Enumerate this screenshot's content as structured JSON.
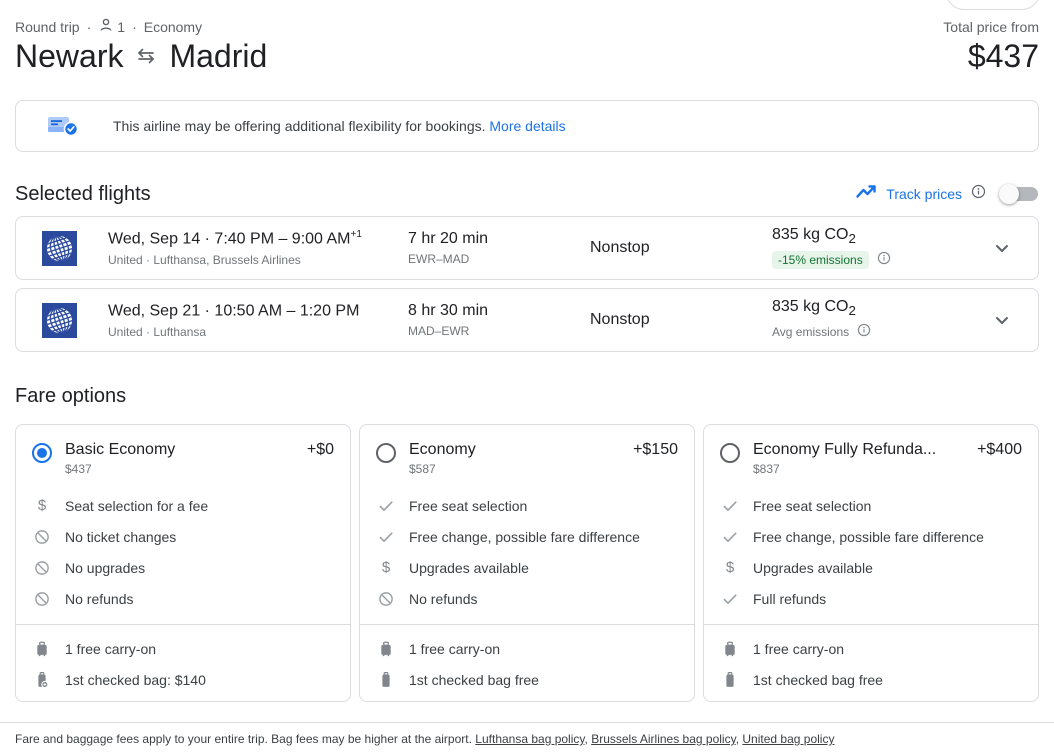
{
  "colors": {
    "accent": "#1a73e8",
    "emissions_badge_bg": "#e6f4ea",
    "emissions_badge_text": "#137333",
    "border": "#dadce0",
    "united_logo_blue": "#2b4a9e"
  },
  "icons": {
    "dollar": "$"
  },
  "header": {
    "trip_type": "Round trip",
    "dot": "·",
    "passengers": "1",
    "cabin": "Economy",
    "total_price_label": "Total price from",
    "origin": "Newark",
    "destination": "Madrid",
    "total_price": "$437"
  },
  "banner": {
    "message": "This airline may be offering additional flexibility for bookings.",
    "link_label": "More details"
  },
  "selected_flights": {
    "heading": "Selected flights",
    "track_prices_label": "Track prices",
    "flights": [
      {
        "datetime": "Wed, Sep 14  ·  7:40 PM – 9:00 AM",
        "plus_days": "+1",
        "airlines": "United · Lufthansa, Brussels Airlines",
        "duration": "7 hr 20 min",
        "route": "EWR–MAD",
        "stops": "Nonstop",
        "co2_value": "835 kg CO",
        "co2_subscript": "2",
        "emissions_label": "-15% emissions"
      },
      {
        "datetime": "Wed, Sep 21  ·  10:50 AM – 1:20 PM",
        "plus_days": "",
        "airlines": "United · Lufthansa",
        "duration": "8 hr 30 min",
        "route": "MAD–EWR",
        "stops": "Nonstop",
        "co2_value": "835 kg CO",
        "co2_subscript": "2",
        "emissions_label": "Avg emissions"
      }
    ]
  },
  "fare_options": {
    "heading": "Fare options",
    "fares": [
      {
        "name": "Basic Economy",
        "base_price": "$437",
        "price_delta": "+$0",
        "selected": true,
        "features": [
          {
            "icon": "dollar-icon",
            "text": "Seat selection for a fee"
          },
          {
            "icon": "not-available-icon",
            "text": "No ticket changes"
          },
          {
            "icon": "not-available-icon",
            "text": "No upgrades"
          },
          {
            "icon": "not-available-icon",
            "text": "No refunds"
          }
        ],
        "baggage": [
          {
            "icon": "carry-on-bag-icon",
            "text": "1 free carry-on"
          },
          {
            "icon": "checked-bag-fee-icon",
            "text": "1st checked bag: $140"
          }
        ]
      },
      {
        "name": "Economy",
        "base_price": "$587",
        "price_delta": "+$150",
        "selected": false,
        "features": [
          {
            "icon": "check-icon",
            "text": "Free seat selection"
          },
          {
            "icon": "check-icon",
            "text": "Free change, possible fare difference"
          },
          {
            "icon": "dollar-icon",
            "text": "Upgrades available"
          },
          {
            "icon": "not-available-icon",
            "text": "No refunds"
          }
        ],
        "baggage": [
          {
            "icon": "carry-on-bag-icon",
            "text": "1 free carry-on"
          },
          {
            "icon": "checked-bag-icon",
            "text": "1st checked bag free"
          }
        ]
      },
      {
        "name": "Economy Fully Refunda...",
        "base_price": "$837",
        "price_delta": "+$400",
        "selected": false,
        "features": [
          {
            "icon": "check-icon",
            "text": "Free seat selection"
          },
          {
            "icon": "check-icon",
            "text": "Free change, possible fare difference"
          },
          {
            "icon": "dollar-icon",
            "text": "Upgrades available"
          },
          {
            "icon": "check-icon",
            "text": "Full refunds"
          }
        ],
        "baggage": [
          {
            "icon": "carry-on-bag-icon",
            "text": "1 free carry-on"
          },
          {
            "icon": "checked-bag-icon",
            "text": "1st checked bag free"
          }
        ]
      }
    ]
  },
  "footer": {
    "text": "Fare and baggage fees apply to your entire trip. Bag fees may be higher at the airport.",
    "links": [
      "Lufthansa bag policy",
      "Brussels Airlines bag policy",
      "United bag policy"
    ],
    "separator": ","
  }
}
